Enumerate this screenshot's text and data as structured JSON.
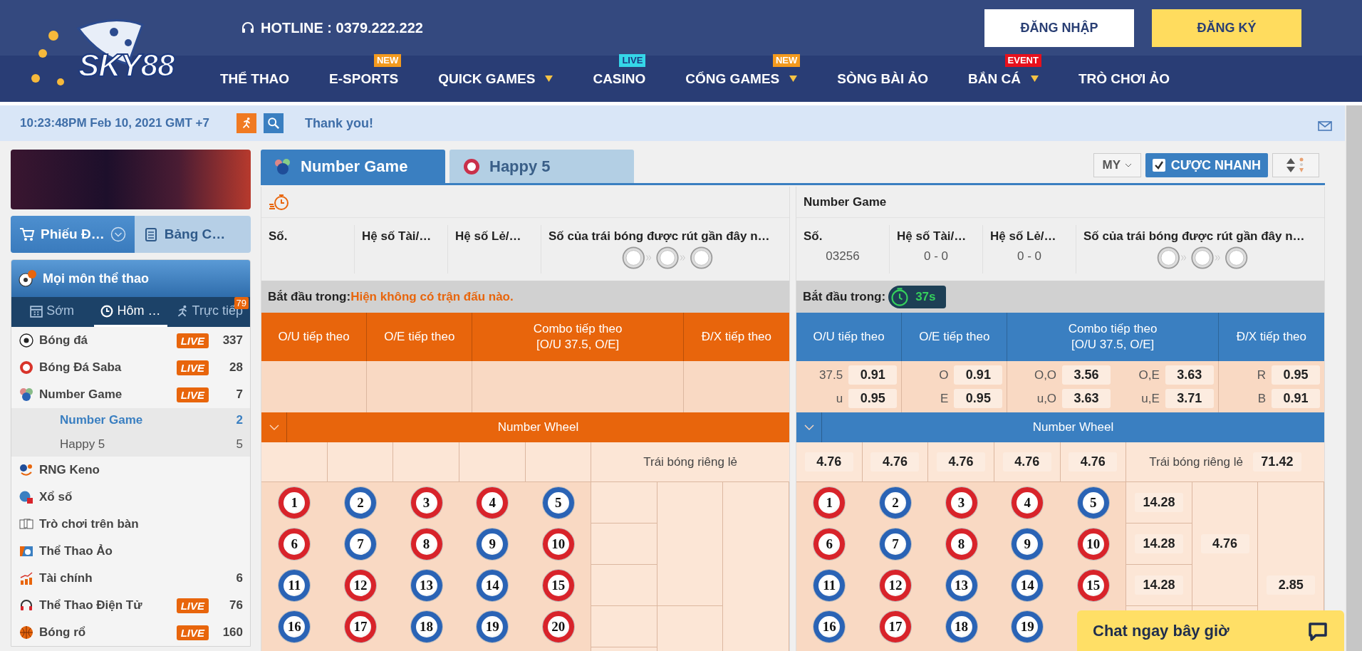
{
  "header": {
    "logo": "SKY88",
    "hotline": "HOTLINE : 0379.222.222",
    "auth_buttons": [
      {
        "label": "ĐĂNG NHẬP",
        "kind": "login"
      },
      {
        "label": "ĐĂNG KÝ",
        "kind": "register"
      }
    ],
    "nav": [
      {
        "label": "THỂ THAO",
        "dropdown": false
      },
      {
        "label": "E-SPORTS",
        "dropdown": false,
        "badge": {
          "text": "NEW",
          "color": "#f39a1e"
        }
      },
      {
        "label": "QUICK GAMES",
        "dropdown": true
      },
      {
        "label": "CASINO",
        "dropdown": false,
        "badge": {
          "text": "LIVE",
          "color": "#35d6e8"
        }
      },
      {
        "label": "CỔNG GAMES",
        "dropdown": true,
        "badge": {
          "text": "NEW",
          "color": "#f39a1e"
        }
      },
      {
        "label": "SÒNG BÀI ẢO",
        "dropdown": false
      },
      {
        "label": "BẮN CÁ",
        "dropdown": true,
        "badge": {
          "text": "EVENT",
          "color": "#e8101c"
        }
      },
      {
        "label": "TRÒ CHƠI ẢO",
        "dropdown": false
      }
    ]
  },
  "info_bar": {
    "time": "10:23:48PM Feb 10, 2021 GMT +7",
    "message": "Thank you!"
  },
  "sidebar": {
    "bet_tabs": [
      {
        "label": "Phiếu Đ…",
        "selected": true
      },
      {
        "label": "Bảng C…",
        "selected": false
      }
    ],
    "sports_panel": {
      "title": "Mọi môn thể thao",
      "periods": [
        {
          "label": "Sớm",
          "selected": false
        },
        {
          "label": "Hôm …",
          "selected": true
        },
        {
          "label": "Trực tiếp",
          "selected": false,
          "badge": "79"
        }
      ],
      "sports": [
        {
          "name": "Bóng đá",
          "live_badge": "LIVE",
          "count": "337"
        },
        {
          "name": "Bóng Đá Saba",
          "live_badge": "LIVE",
          "count": "28"
        },
        {
          "name": "Number Game",
          "live_badge": "LIVE",
          "count": "7",
          "children": [
            {
              "name": "Number Game",
              "count": "2",
              "selected": true
            },
            {
              "name": "Happy 5",
              "count": "5",
              "selected": false
            }
          ]
        },
        {
          "name": "RNG Keno"
        },
        {
          "name": "Xổ số"
        },
        {
          "name": "Trò chơi trên bàn"
        },
        {
          "name": "Thể Thao Ảo"
        },
        {
          "name": "Tài chính",
          "count": "6"
        },
        {
          "name": "Thể Thao Điện Tử",
          "live_badge": "LIVE",
          "count": "76"
        },
        {
          "name": "Bóng rổ",
          "live_badge": "LIVE",
          "count": "160"
        }
      ]
    }
  },
  "game_tabs": [
    {
      "label": "Number Game",
      "selected": true
    },
    {
      "label": "Happy 5",
      "selected": false
    }
  ],
  "toolbar": {
    "odds_type": "MY",
    "quick_bet": {
      "label": "CƯỢC NHANH",
      "checked": true
    }
  },
  "panels": [
    {
      "kind": "idle",
      "info_columns": [
        {
          "heading": "Số."
        },
        {
          "heading": "Hệ số Tài/…"
        },
        {
          "heading": "Hệ số Lẻ/…"
        }
      ],
      "recent_heading": "Số của trái bóng được rút gần đây n…",
      "start_label": "Bắt đầu trong:",
      "start_message": "Hiện không có trận đấu nào.",
      "markets": [
        {
          "title": "O/U tiếp theo"
        },
        {
          "title": "O/E tiếp theo"
        },
        {
          "title": "Combo tiếp theo",
          "subtitle": "[O/U 37.5, O/E]"
        },
        {
          "title": "Đ/X tiếp theo"
        }
      ],
      "wheel_title": "Number Wheel",
      "singles_label": "Trái bóng riêng lẻ",
      "balls": [
        {
          "number": "1",
          "color": "#d8232a"
        },
        {
          "number": "2",
          "color": "#2a63b5"
        },
        {
          "number": "3",
          "color": "#d8232a"
        },
        {
          "number": "4",
          "color": "#d8232a"
        },
        {
          "number": "5",
          "color": "#2a63b5"
        },
        {
          "number": "6",
          "color": "#d8232a"
        },
        {
          "number": "7",
          "color": "#2a63b5"
        },
        {
          "number": "8",
          "color": "#d8232a"
        },
        {
          "number": "9",
          "color": "#2a63b5"
        },
        {
          "number": "10",
          "color": "#d8232a"
        },
        {
          "number": "11",
          "color": "#2a63b5"
        },
        {
          "number": "12",
          "color": "#d8232a"
        },
        {
          "number": "13",
          "color": "#2a63b5"
        },
        {
          "number": "14",
          "color": "#2a63b5"
        },
        {
          "number": "15",
          "color": "#d8232a"
        },
        {
          "number": "16",
          "color": "#2a63b5"
        },
        {
          "number": "17",
          "color": "#d8232a"
        },
        {
          "number": "18",
          "color": "#2a63b5"
        },
        {
          "number": "19",
          "color": "#2a63b5"
        },
        {
          "number": "20",
          "color": "#d8232a"
        }
      ]
    },
    {
      "kind": "active",
      "title": "Number Game",
      "info_columns": [
        {
          "heading": "Số.",
          "value": "03256"
        },
        {
          "heading": "Hệ số Tài/…",
          "value": "0 - 0"
        },
        {
          "heading": "Hệ số Lẻ/…",
          "value": "0 - 0"
        }
      ],
      "recent_heading": "Số của trái bóng được rút gần đây n…",
      "start_label": "Bắt đầu trong:",
      "countdown": "37s",
      "markets": [
        {
          "title": "O/U tiếp theo",
          "odds": [
            {
              "label": "37.5",
              "value": "0.91"
            },
            {
              "label": "u",
              "value": "0.95"
            }
          ]
        },
        {
          "title": "O/E tiếp theo",
          "odds": [
            {
              "label": "O",
              "value": "0.91"
            },
            {
              "label": "E",
              "value": "0.95"
            }
          ]
        },
        {
          "title": "Combo tiếp theo",
          "subtitle": "[O/U 37.5, O/E]",
          "odds": [
            {
              "label": "O,O",
              "value": "3.56"
            },
            {
              "label": "O,E",
              "value": "3.63"
            },
            {
              "label": "u,O",
              "value": "3.63"
            },
            {
              "label": "u,E",
              "value": "3.71"
            }
          ]
        },
        {
          "title": "Đ/X tiếp theo",
          "odds": [
            {
              "label": "R",
              "value": "0.95"
            },
            {
              "label": "B",
              "value": "0.91"
            }
          ]
        }
      ],
      "wheel_title": "Number Wheel",
      "singles_odds": [
        "4.76",
        "4.76",
        "4.76",
        "4.76",
        "4.76"
      ],
      "singles_label": "Trái bóng riêng lẻ",
      "singles_total": "71.42",
      "side_odds": {
        "column_1": [
          "14.28",
          "14.28",
          "14.28"
        ],
        "column_2": "4.76",
        "column_3": "2.85"
      },
      "balls": [
        {
          "number": "1",
          "color": "#d8232a"
        },
        {
          "number": "2",
          "color": "#2a63b5"
        },
        {
          "number": "3",
          "color": "#d8232a"
        },
        {
          "number": "4",
          "color": "#d8232a"
        },
        {
          "number": "5",
          "color": "#2a63b5"
        },
        {
          "number": "6",
          "color": "#d8232a"
        },
        {
          "number": "7",
          "color": "#2a63b5"
        },
        {
          "number": "8",
          "color": "#d8232a"
        },
        {
          "number": "9",
          "color": "#2a63b5"
        },
        {
          "number": "10",
          "color": "#d8232a"
        },
        {
          "number": "11",
          "color": "#2a63b5"
        },
        {
          "number": "12",
          "color": "#d8232a"
        },
        {
          "number": "13",
          "color": "#2a63b5"
        },
        {
          "number": "14",
          "color": "#2a63b5"
        },
        {
          "number": "15",
          "color": "#d8232a"
        },
        {
          "number": "16",
          "color": "#2a63b5"
        },
        {
          "number": "17",
          "color": "#d8232a"
        },
        {
          "number": "18",
          "color": "#2a63b5"
        },
        {
          "number": "19",
          "color": "#2a63b5"
        }
      ]
    }
  ],
  "chat": {
    "label": "Chat ngay bây giờ"
  }
}
